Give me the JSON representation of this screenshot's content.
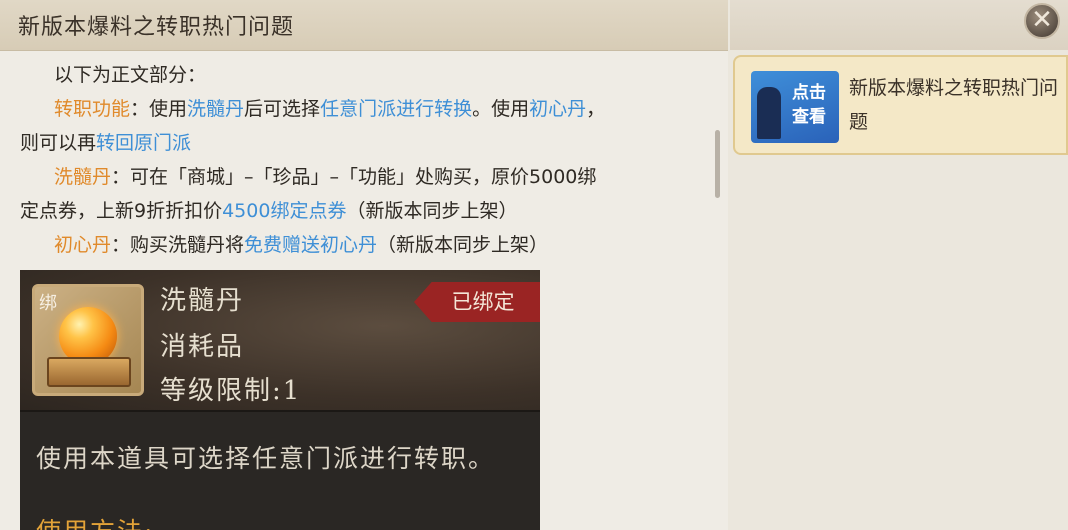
{
  "header": {
    "title": "新版本爆料之转职热门问题",
    "close_glyph": "✕"
  },
  "article": {
    "intro": "以下为正文部分：",
    "line2": {
      "label": "转职功能",
      "sep": "：使用",
      "link1": "洗髓丹",
      "text1": "后可选择",
      "link2": "任意门派进行转换",
      "text2": "。使用",
      "link3": "初心丹",
      "text3": "，"
    },
    "line3": {
      "text": "则可以再",
      "link": "转回原门派"
    },
    "line4": {
      "label": "洗髓丹",
      "text": "：可在「商城」–「珍品」–「功能」处购买，原价5000绑"
    },
    "line5": {
      "text1": "定点券，上新9折折扣价",
      "link": "4500绑定点券",
      "text2": "（新版本同步上架）"
    },
    "line6": {
      "label": "初心丹",
      "text1": "：购买洗髓丹将",
      "link": "免费赠送初心丹",
      "text2": "（新版本同步上架）"
    }
  },
  "item_card": {
    "bind_tag": "绑",
    "name": "洗髓丹",
    "type": "消耗品",
    "level": "等级限制:1",
    "status": "已绑定",
    "description": "使用本道具可选择任意门派进行转职。",
    "usage_label": "使用方法:"
  },
  "related": {
    "thumb_text": "点击查看",
    "title": "新版本爆料之转职热门问题"
  }
}
